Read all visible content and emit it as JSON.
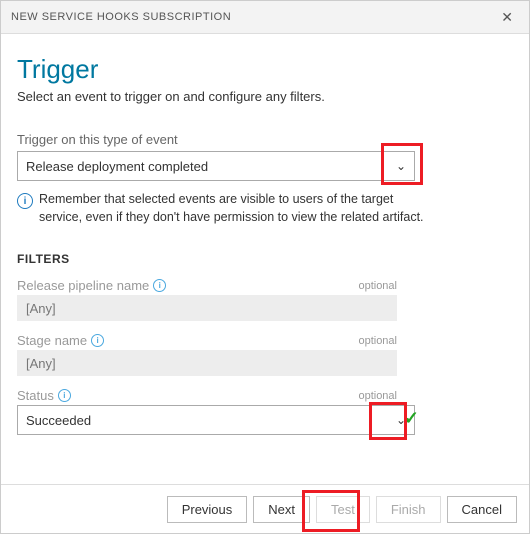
{
  "header": {
    "title": "NEW SERVICE HOOKS SUBSCRIPTION"
  },
  "page": {
    "title": "Trigger",
    "subtitle": "Select an event to trigger on and configure any filters."
  },
  "event": {
    "label": "Trigger on this type of event",
    "value": "Release deployment completed",
    "info": "Remember that selected events are visible to users of the target service, even if they don't have permission to view the related artifact."
  },
  "filters": {
    "heading": "FILTERS",
    "pipeline": {
      "label": "Release pipeline name",
      "value": "[Any]",
      "optional": "optional"
    },
    "stage": {
      "label": "Stage name",
      "value": "[Any]",
      "optional": "optional"
    },
    "status": {
      "label": "Status",
      "value": "Succeeded",
      "optional": "optional"
    }
  },
  "footer": {
    "previous": "Previous",
    "next": "Next",
    "test": "Test",
    "finish": "Finish",
    "cancel": "Cancel"
  }
}
